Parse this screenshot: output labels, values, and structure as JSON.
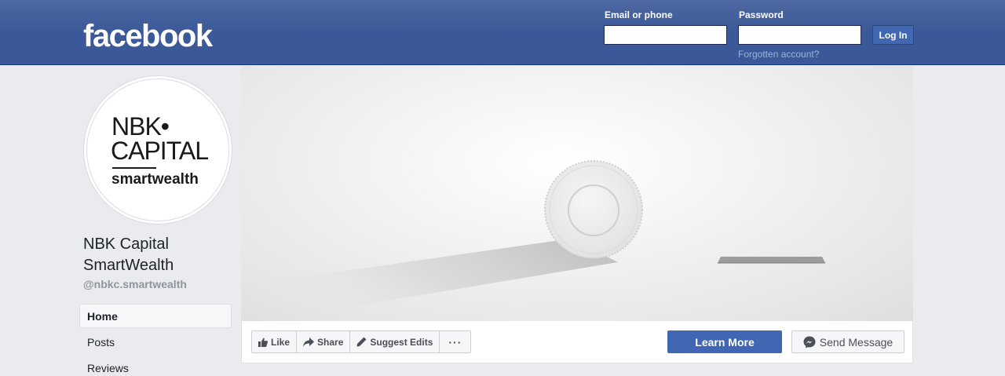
{
  "header": {
    "logo": "facebook",
    "email_label": "Email or phone",
    "email_value": "",
    "password_label": "Password",
    "password_value": "",
    "login_button": "Log In",
    "forgot_link": "Forgotten account?"
  },
  "profile": {
    "logo_line1": "NBK•",
    "logo_line2": "CAPITAL",
    "logo_line3": "smartwealth",
    "name": "NBK Capital SmartWealth",
    "handle": "@nbkc.smartwealth"
  },
  "nav": {
    "items": [
      {
        "label": "Home",
        "active": true
      },
      {
        "label": "Posts",
        "active": false
      },
      {
        "label": "Reviews",
        "active": false
      }
    ]
  },
  "actions": {
    "like": "Like",
    "share": "Share",
    "suggest_edits": "Suggest Edits",
    "more": "···",
    "learn_more": "Learn More",
    "send_message": "Send Message"
  },
  "colors": {
    "brand_blue": "#3b5998",
    "button_blue": "#4267b2",
    "page_bg": "#e9ebee"
  }
}
